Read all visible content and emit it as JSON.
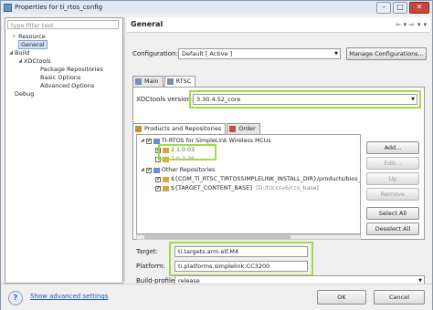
{
  "window": {
    "title": "Properties for ti_rtos_config"
  },
  "title_controls": {
    "minimize": "–",
    "maximize": "□",
    "close": "✕"
  },
  "left_panel": {
    "filter_placeholder": "type filter text",
    "tree": [
      {
        "label": "Resource",
        "level": 1,
        "expandable": true
      },
      {
        "label": "General",
        "level": 1,
        "selected": true
      },
      {
        "label": "Build",
        "level": 0,
        "expandable": true,
        "expanded": true
      },
      {
        "label": "XDCtools",
        "level": 1,
        "expandable": true,
        "expanded": true
      },
      {
        "label": "Package Repositories",
        "level": 2
      },
      {
        "label": "Basic Options",
        "level": 2
      },
      {
        "label": "Advanced Options",
        "level": 2
      },
      {
        "label": "Debug",
        "level": 0
      }
    ]
  },
  "header": {
    "title": "General",
    "nav_back": "⇦",
    "nav_back_menu": "▾",
    "nav_forward": "⇨",
    "nav_forward_menu": "▾",
    "nav_menu": "▾"
  },
  "configuration": {
    "label": "Configuration:",
    "value": "Default  [ Active ]",
    "manage_button": "Manage Configurations..."
  },
  "tabs": [
    {
      "label": "Main",
      "active": false
    },
    {
      "label": "RTSC",
      "active": true
    }
  ],
  "rtsc": {
    "xdctools_label": "XDCtools version:",
    "xdctools_value": "3.30.4.52_core",
    "inner_tabs": [
      {
        "label": "Products and Repositories",
        "active": true
      },
      {
        "label": "Order",
        "active": false
      }
    ],
    "repositories": [
      {
        "label": "TI-RTOS for SimpleLink Wireless MCUs",
        "indent": 0,
        "checked": true,
        "expanded": true
      },
      {
        "label": "2.1.0.03",
        "indent": 1,
        "checked": true,
        "style": "green"
      },
      {
        "label": "2.0.2.36",
        "indent": 1,
        "checked": false,
        "style": "normal"
      },
      {
        "label": "Other Repositories",
        "indent": 0,
        "checked": true,
        "expanded": true
      },
      {
        "label": "${COM_TI_RTSC_TIRTOSSIMPLELINK_INSTALL_DIR}/products/bios_s",
        "indent": 1,
        "checked": true,
        "style": "normal"
      },
      {
        "label": "${TARGET_CONTENT_BASE}",
        "suffix": "[D:/ti/ccsv6/ccs_base]",
        "indent": 1,
        "checked": true,
        "style": "normal"
      }
    ],
    "buttons": {
      "add": "Add...",
      "edit": "Edit...",
      "up": "Up",
      "remove": "Remove",
      "select_all": "Select All",
      "deselect_all": "Deselect All"
    },
    "target_label": "Target:",
    "target_value": "ti.targets.arm.elf.M4",
    "platform_label": "Platform:",
    "platform_value": "ti.platforms.simplelink:CC3200",
    "build_profile_label": "Build-profile:",
    "build_profile_value": "release"
  },
  "footer": {
    "help": "?",
    "show_advanced": "Show advanced settings",
    "ok": "OK",
    "cancel": "Cancel"
  },
  "colors": {
    "highlight": "#a6d84a",
    "selection": "#cfe3fa",
    "link": "#1a5bb5"
  }
}
